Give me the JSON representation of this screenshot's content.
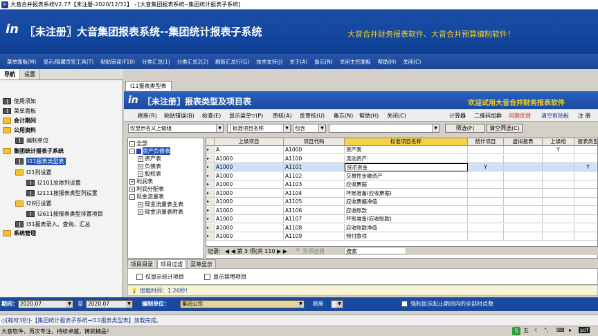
{
  "window": {
    "title": "大音合并报表系统V2.77【未注册-2020/12/31】 - [大音集团报表系统--集团统计报表子系统]"
  },
  "banner": {
    "logo": "in",
    "title": "〖未注册〗大音集团报表系统--集团统计报表子系统",
    "slogan": "大音合并财务报表软件、大音合并预算编制软件！"
  },
  "menu": [
    "菜单面板(M)",
    "显示/隐藏页签工具(T)",
    "粘贴错误(F10)",
    "分类汇总(1)",
    "分类汇总2(2)",
    "刷新汇总行(G)",
    "技术支持(J)",
    "关于(A)",
    "备忘(N)",
    "关闭主控面板",
    "帮助(H)",
    "关闭(C)"
  ],
  "left": {
    "tabs": [
      "导航",
      "设置"
    ],
    "items": [
      {
        "label": "使用须知"
      },
      {
        "label": "菜单面板"
      },
      {
        "label": "会计期间"
      },
      {
        "label": "公用资料"
      },
      {
        "label": "编制单位"
      },
      {
        "label": "集团统计报表子系统"
      },
      {
        "label": "I11报表类型表"
      },
      {
        "label": "I21列设置"
      },
      {
        "label": "I2101总体列设置"
      },
      {
        "label": "I2111按报表类型列设置"
      },
      {
        "label": "I26行设置"
      },
      {
        "label": "I2611按报表类型排置项目"
      },
      {
        "label": "I31报表录入、查询、汇总"
      },
      {
        "label": "系统管理"
      }
    ]
  },
  "main": {
    "tab": "I11报表类型表",
    "logo": "in",
    "title": "〖未注册〗报表类型及项目表",
    "welcome": "欢迎试用大音合并财务报表软件",
    "toolbar": [
      "刷新(R)",
      "粘贴错误(B)",
      "检查(E)",
      "显示菜单▽(P)",
      "审核(A)",
      "反审核(U)",
      "备忘(N)",
      "帮助(H)",
      "关闭(C)",
      "计算器",
      "二维码加群",
      "问题反馈",
      "清空剪贴板",
      "注 册"
    ],
    "toolbar_colors": {
      "feedback": "#d02020",
      "clip": "#1030a0"
    },
    "filter": {
      "combo1": "仅显示名义上级组",
      "combo2": "",
      "field": "标准项目名称",
      "op": "包含",
      "value": "",
      "filter_btn": "筛选(F)",
      "clear_btn": "清空筛选(C)"
    },
    "tree": [
      {
        "label": "全部",
        "box": "-"
      },
      {
        "label": "资产负债表",
        "box": "-"
      },
      {
        "label": "资产表",
        "box": "+"
      },
      {
        "label": "负债表",
        "box": "+"
      },
      {
        "label": "股权表",
        "box": "+"
      },
      {
        "label": "利润表",
        "box": "+"
      },
      {
        "label": "利润分配表",
        "box": "+"
      },
      {
        "label": "现金流量表",
        "box": "-"
      },
      {
        "label": "现金流量表主表",
        "box": "+"
      },
      {
        "label": "现金流量表附表",
        "box": "+"
      }
    ],
    "grid": {
      "headers": [
        "上级项目",
        "项目代码",
        "标准项目名称",
        "统计项目",
        "虚拟报表",
        "上级组",
        "报表类型"
      ],
      "rows": [
        [
          "A",
          "A1000",
          "资产表",
          "",
          "",
          "Y",
          ""
        ],
        [
          "A1000",
          "A1100",
          "流动资产:",
          "",
          "",
          "",
          ""
        ],
        [
          "A1000",
          "A1101",
          "货币资金",
          "Y",
          "",
          "",
          "Y"
        ],
        [
          "A1000",
          "A1102",
          "交易性金融资产",
          "",
          "",
          "",
          ""
        ],
        [
          "A1000",
          "A1103",
          "应收票据",
          "",
          "",
          "",
          ""
        ],
        [
          "A1000",
          "A1104",
          "坏账准备(应收票据)",
          "",
          "",
          "",
          ""
        ],
        [
          "A1000",
          "A1105",
          "应收票据净值",
          "",
          "",
          "",
          ""
        ],
        [
          "A1000",
          "A1106",
          "应收账款",
          "",
          "",
          "",
          ""
        ],
        [
          "A1000",
          "A1107",
          "坏账准备(应收账款)",
          "",
          "",
          "",
          ""
        ],
        [
          "A1000",
          "A1108",
          "应收账款净值",
          "",
          "",
          "",
          ""
        ],
        [
          "A1000",
          "A1109",
          "预付款项",
          "",
          "",
          "",
          ""
        ]
      ],
      "footer": {
        "record_label": "记录:",
        "nav": "◀ ◀ 第 3 项(共 110 ▶ ▶",
        "filter_status": "无筛选器",
        "search": "搜索"
      }
    },
    "bottom_tabs": [
      "项目目录",
      "项目过滤",
      "菜单显示"
    ],
    "options": [
      "仅显示统计项目",
      "显示禁用项目"
    ],
    "timing": "加载时间：1.26秒!"
  },
  "datebar": {
    "start_label": "期间：",
    "start": "2020.07",
    "to": "至",
    "end": "2020.07",
    "unit_label": "编制单位：",
    "unit": "集团公司",
    "refresh": "刷新",
    "check": "强制显示起止期间内的全部时点数"
  },
  "status1": "◇[耗时3秒]-【集团统计报表子系统→I11报表类型表】加载完成。",
  "status2": "大音软件，再次专注，持续卓越，铸就精品！",
  "tray": {
    "ime": "五",
    "app": "sof"
  }
}
